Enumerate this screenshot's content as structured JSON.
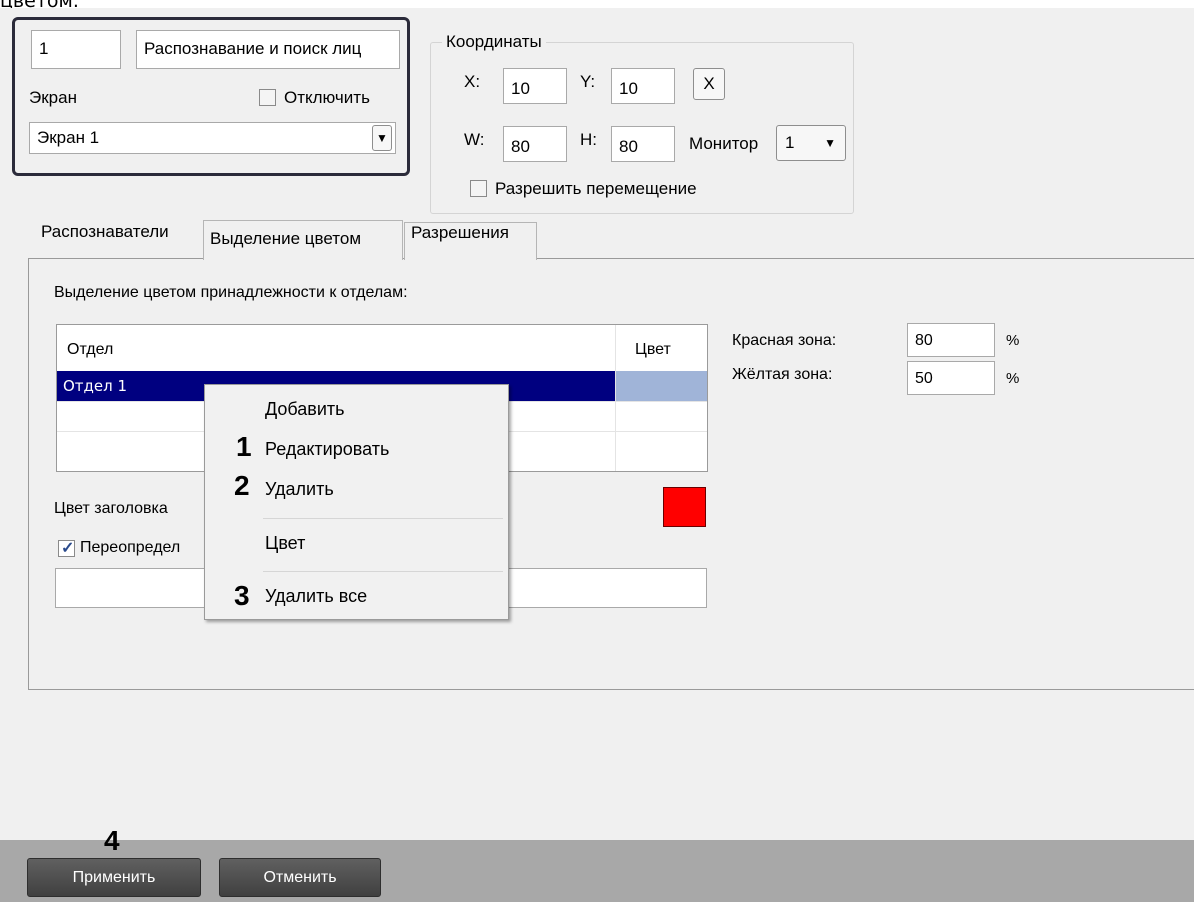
{
  "heading_fragment": "цветом.",
  "object": {
    "id": "1",
    "name": "Распознавание и поиск лиц",
    "screen_label": "Экран",
    "disable_label": "Отключить",
    "screen_value": "Экран 1"
  },
  "coords": {
    "legend": "Координаты",
    "x_label": "X:",
    "x_value": "10",
    "y_label": "Y:",
    "y_value": "10",
    "clear_button": "X",
    "w_label": "W:",
    "w_value": "80",
    "h_label": "H:",
    "h_value": "80",
    "monitor_label": "Монитор",
    "monitor_value": "1",
    "allow_move_label": "Разрешить перемещение"
  },
  "tabs": [
    {
      "label": "Распознаватели"
    },
    {
      "label": "Выделение цветом"
    },
    {
      "label": "Разрешения"
    }
  ],
  "color_tab": {
    "section_label": "Выделение цветом принадлежности к отделам:",
    "grid": {
      "columns": [
        "Отдел",
        "Цвет"
      ],
      "rows": [
        {
          "dept": "Отдел 1",
          "color": ""
        }
      ]
    },
    "red_zone_label": "Красная зона:",
    "red_zone_value": "80",
    "red_zone_unit": "%",
    "yellow_zone_label": "Жёлтая зона:",
    "yellow_zone_value": "50",
    "yellow_zone_unit": "%",
    "header_color_label": "Цвет заголовка",
    "override_label": "Переопредел",
    "override_input_value": ""
  },
  "context_menu": {
    "items": [
      "Добавить",
      "Редактировать",
      "Удалить",
      "Цвет",
      "Удалить все"
    ]
  },
  "callouts": [
    "1",
    "2",
    "3",
    "4"
  ],
  "footer": {
    "apply": "Применить",
    "cancel": "Отменить"
  },
  "colors": {
    "selection": "#000080",
    "color_cell": "#a0b4d8",
    "header_swatch": "#ff0000",
    "footer_bg": "#a8a8a8",
    "panel_bg": "#f0f0f0"
  }
}
